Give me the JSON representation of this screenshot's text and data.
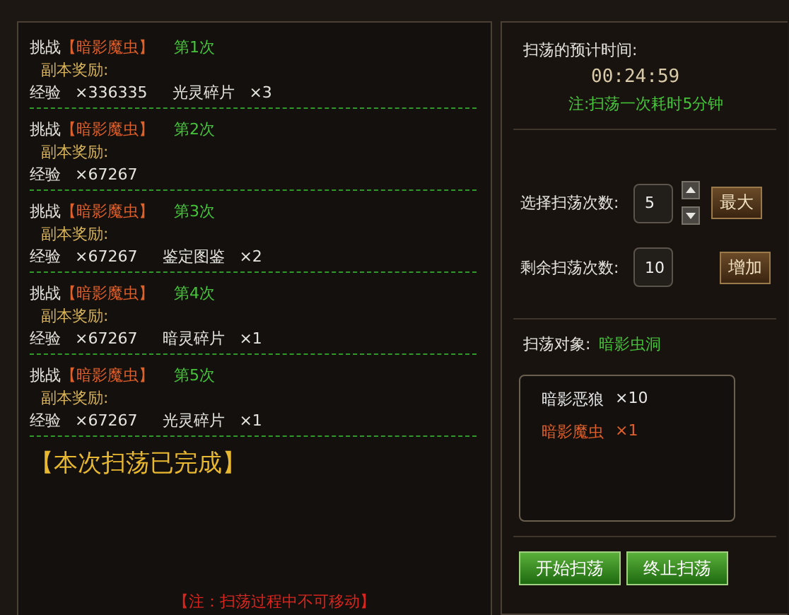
{
  "rounds": [
    {
      "action": "挑战",
      "target": "【暗影魔虫】",
      "count": "第1次",
      "reward_label": "副本奖励:",
      "rewards": [
        {
          "name": "经验",
          "amount": "×336335"
        },
        {
          "name": "光灵碎片",
          "amount": "×3"
        }
      ]
    },
    {
      "action": "挑战",
      "target": "【暗影魔虫】",
      "count": "第2次",
      "reward_label": "副本奖励:",
      "rewards": [
        {
          "name": "经验",
          "amount": "×67267"
        }
      ]
    },
    {
      "action": "挑战",
      "target": "【暗影魔虫】",
      "count": "第3次",
      "reward_label": "副本奖励:",
      "rewards": [
        {
          "name": "经验",
          "amount": "×67267"
        },
        {
          "name": "鉴定图鉴",
          "amount": "×2"
        }
      ]
    },
    {
      "action": "挑战",
      "target": "【暗影魔虫】",
      "count": "第4次",
      "reward_label": "副本奖励:",
      "rewards": [
        {
          "name": "经验",
          "amount": "×67267"
        },
        {
          "name": "暗灵碎片",
          "amount": "×1"
        }
      ]
    },
    {
      "action": "挑战",
      "target": "【暗影魔虫】",
      "count": "第5次",
      "reward_label": "副本奖励:",
      "rewards": [
        {
          "name": "经验",
          "amount": "×67267"
        },
        {
          "name": "光灵碎片",
          "amount": "×1"
        }
      ]
    }
  ],
  "completed": "【本次扫荡已完成】",
  "footer_note": "【注：扫荡过程中不可移动】",
  "estimate": {
    "label": "扫荡的预计时间:",
    "time": "00:24:59",
    "note": "注:扫荡一次耗时5分钟"
  },
  "select_count": {
    "label": "选择扫荡次数:",
    "value": "5",
    "button": "最大"
  },
  "remaining_count": {
    "label": "剩余扫荡次数:",
    "value": "10",
    "button": "增加"
  },
  "target": {
    "label": "扫荡对象:",
    "value": "暗影虫洞"
  },
  "monsters": [
    {
      "name": "暗影恶狼",
      "amount": "×10",
      "color": "#e8e8e8"
    },
    {
      "name": "暗影魔虫",
      "amount": "×1",
      "color": "#e0602a"
    }
  ],
  "buttons": [
    "开始扫荡",
    "终止扫荡"
  ]
}
